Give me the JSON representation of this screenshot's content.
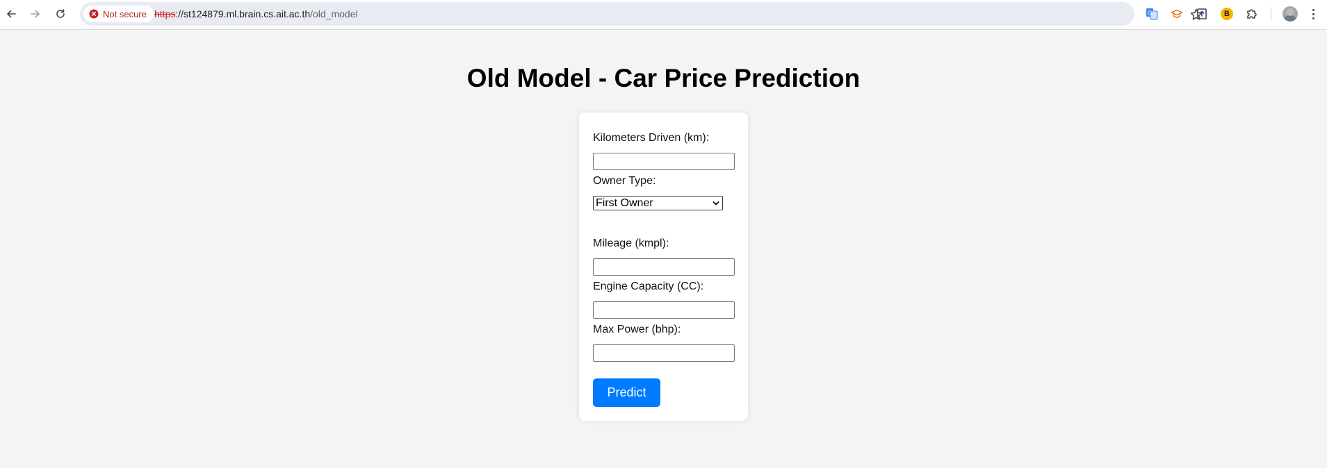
{
  "browser": {
    "security_label": "Not secure",
    "url": {
      "scheme": "https",
      "rest_host": "://st124879.ml.brain.cs.ait.ac.th",
      "path": "/old_model"
    },
    "extensions": [
      "translate-icon",
      "graduation-cap-icon",
      "upload-box-icon",
      "b-badge-icon",
      "puzzle-icon"
    ],
    "extension_b_letter": "B"
  },
  "page": {
    "title": "Old Model - Car Price Prediction"
  },
  "form": {
    "km_label": "Kilometers Driven (km):",
    "km_value": "",
    "owner_label": "Owner Type:",
    "owner_selected": "First Owner",
    "mileage_label": "Mileage (kmpl):",
    "mileage_value": "",
    "engine_label": "Engine Capacity (CC):",
    "engine_value": "",
    "power_label": "Max Power (bhp):",
    "power_value": "",
    "submit_label": "Predict"
  },
  "colors": {
    "page_background": "#f4f4f4",
    "card_background": "#ffffff",
    "button_primary": "#007bff",
    "not_secure": "#b3261e"
  }
}
